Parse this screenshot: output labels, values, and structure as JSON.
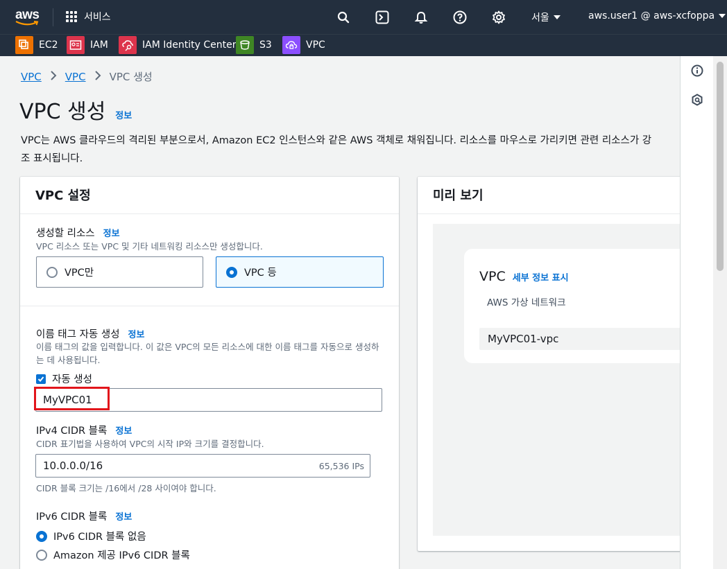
{
  "topnav": {
    "services_label": "서비스",
    "region": "서울",
    "account": "aws.user1 @ aws-xcfoppa"
  },
  "favorites": [
    {
      "label": "EC2",
      "color": "#ed7100"
    },
    {
      "label": "IAM",
      "color": "#dd344c"
    },
    {
      "label": "IAM Identity Center",
      "color": "#dd344c"
    },
    {
      "label": "S3",
      "color": "#3f8624"
    },
    {
      "label": "VPC",
      "color": "#8c4fff"
    }
  ],
  "breadcrumb": {
    "items": [
      "VPC",
      "VPC"
    ],
    "current": "VPC 생성"
  },
  "page": {
    "title": "VPC 생성",
    "info": "정보",
    "description": "VPC는 AWS 클라우드의 격리된 부분으로서, Amazon EC2 인스턴스와 같은 AWS 객체로 채워집니다. 리소스를 마우스로 가리키면 관련 리소스가 강조 표시됩니다."
  },
  "settings": {
    "title": "VPC 설정",
    "resources": {
      "label": "생성할 리소스",
      "info": "정보",
      "description": "VPC 리소스 또는 VPC 및 기타 네트워킹 리소스만 생성합니다.",
      "option_vpc_only": "VPC만",
      "option_vpc_more": "VPC 등",
      "selected": "VPC 등"
    },
    "name_tag": {
      "label": "이름 태그 자동 생성",
      "info": "정보",
      "description": "이름 태그의 값을 입력합니다. 이 값은 VPC의 모든 리소스에 대한 이름 태그를 자동으로 생성하는 데 사용됩니다.",
      "auto_generate_label": "자동 생성",
      "auto_generate_checked": true,
      "value": "MyVPC01"
    },
    "ipv4": {
      "label": "IPv4 CIDR 블록",
      "info": "정보",
      "description": "CIDR 표기법을 사용하여 VPC의 시작 IP와 크기를 결정합니다.",
      "value": "10.0.0.0/16",
      "ip_count": "65,536 IPs",
      "hint": "CIDR 블록 크기는 /16에서 /28 사이여야 합니다."
    },
    "ipv6": {
      "label": "IPv6 CIDR 블록",
      "info": "정보",
      "option_none": "IPv6 CIDR 블록 없음",
      "option_amazon": "Amazon 제공 IPv6 CIDR 블록",
      "selected": "IPv6 CIDR 블록 없음"
    }
  },
  "preview": {
    "title": "미리 보기",
    "vpc_heading": "VPC",
    "details_link": "세부 정보 표시",
    "subtitle": "AWS 가상 네트워크",
    "vpc_name": "MyVPC01-vpc"
  },
  "colors": {
    "nav_bg": "#232f3e",
    "link": "#0972d3",
    "highlight": "#e2151b"
  }
}
